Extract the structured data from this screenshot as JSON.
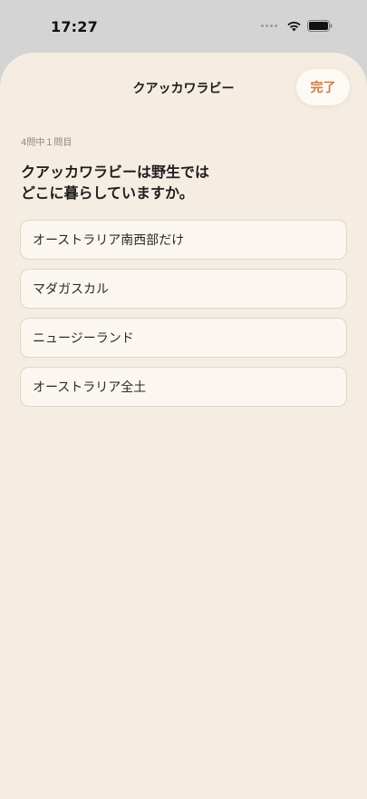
{
  "status_bar": {
    "time": "17:27"
  },
  "header": {
    "title": "クアッカワラビー",
    "done_label": "完了"
  },
  "quiz": {
    "progress": "4問中１問目",
    "question_line1": "クアッカワラビーは野生では",
    "question_line2": "どこに暮らしていますか。",
    "options": [
      {
        "label": "オーストラリア南西部だけ"
      },
      {
        "label": "マダガスカル"
      },
      {
        "label": "ニュージーランド"
      },
      {
        "label": "オーストラリア全土"
      }
    ]
  },
  "colors": {
    "accent": "#d07a3f",
    "sheet_background": "#f5ede2",
    "option_background": "#fbf7f0"
  }
}
